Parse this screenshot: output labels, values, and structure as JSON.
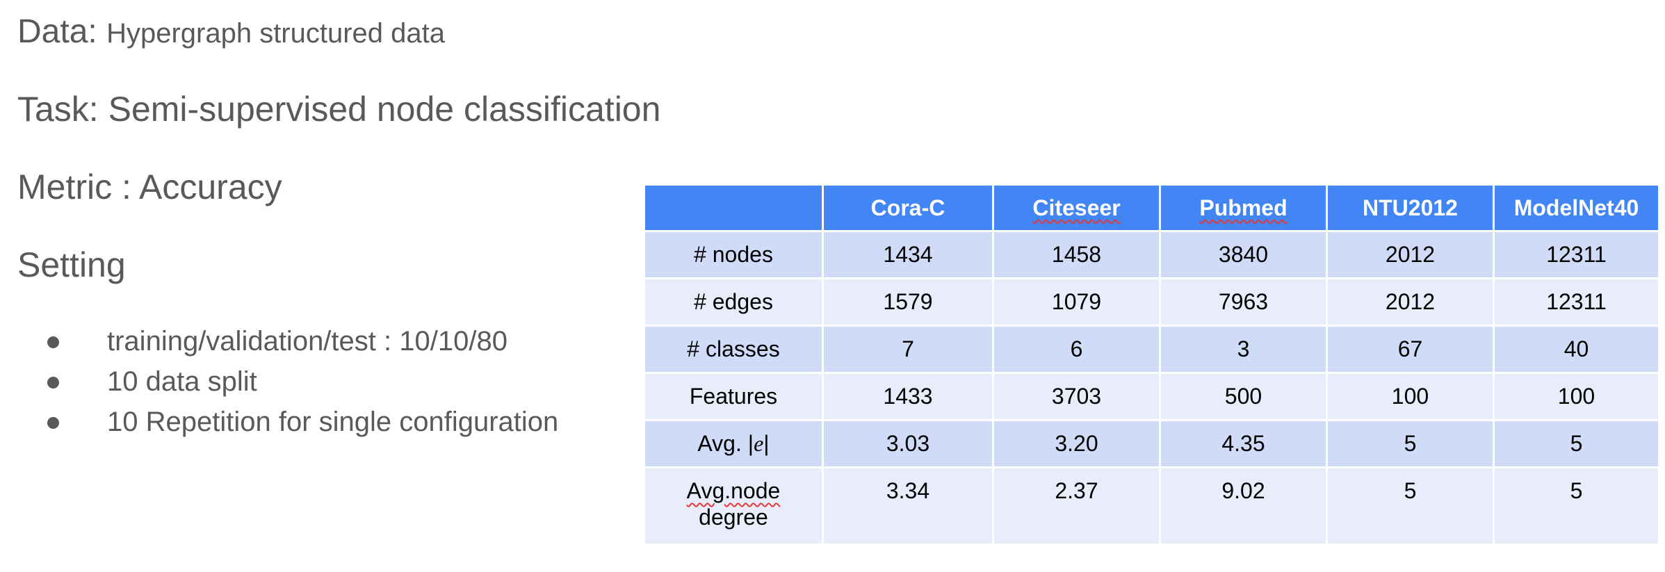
{
  "data_line": {
    "label": "Data:",
    "value": "Hypergraph structured data"
  },
  "task_line": "Task: Semi-supervised node classification",
  "metric_line": "Metric : Accuracy",
  "setting_heading": "Setting",
  "bullets": [
    "training/validation/test : 10/10/80",
    "10 data split",
    "10 Repetition for single configuration"
  ],
  "table": {
    "headers": [
      "",
      "Cora-C",
      "Citeseer",
      "Pubmed",
      "NTU2012",
      "ModelNet40"
    ],
    "rows": [
      {
        "label": "# nodes",
        "values": [
          "1434",
          "1458",
          "3840",
          "2012",
          "12311"
        ]
      },
      {
        "label": "# edges",
        "values": [
          "1579",
          "1079",
          "7963",
          "2012",
          "12311"
        ]
      },
      {
        "label": "# classes",
        "values": [
          "7",
          "6",
          "3",
          "67",
          "40"
        ]
      },
      {
        "label": "Features",
        "values": [
          "1433",
          "3703",
          "500",
          "100",
          "100"
        ]
      },
      {
        "label_prefix": "Avg. |",
        "label_math": "e",
        "label_suffix": "|",
        "values": [
          "3.03",
          "3.20",
          "4.35",
          "5",
          "5"
        ]
      },
      {
        "label_line1": "Avg.node",
        "label_line2": "degree",
        "values": [
          "3.34",
          "2.37",
          "9.02",
          "5",
          "5"
        ]
      }
    ]
  },
  "colors": {
    "header_bg": "#4285f4",
    "row_dark": "#d0dbf8",
    "row_light": "#e8ecfb",
    "text_gray": "#595959"
  }
}
